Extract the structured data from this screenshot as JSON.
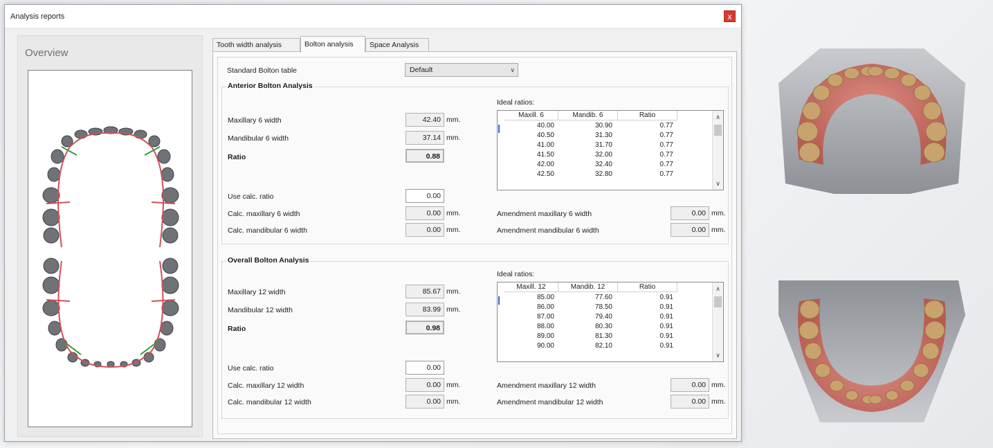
{
  "window": {
    "title": "Analysis reports",
    "close_glyph": "x"
  },
  "overview": {
    "title": "Overview"
  },
  "tabs": [
    {
      "label": "Tooth width analysis",
      "active": false
    },
    {
      "label": "Bolton analysis",
      "active": true
    },
    {
      "label": "Space Analysis",
      "active": false
    }
  ],
  "bolton": {
    "standard_table_label": "Standard Bolton table",
    "standard_table_value": "Default",
    "anterior": {
      "title": "Anterior Bolton Analysis",
      "maxillary_label": "Maxillary 6 width",
      "maxillary_value": "42.40",
      "mandibular_label": "Mandibular 6 width",
      "mandibular_value": "37.14",
      "ratio_label": "Ratio",
      "ratio_value": "0.88",
      "use_calc_label": "Use calc. ratio",
      "use_calc_value": "0.00",
      "calc_max_label": "Calc. maxillary 6 width",
      "calc_max_value": "0.00",
      "calc_mand_label": "Calc. mandibular 6 width",
      "calc_mand_value": "0.00",
      "ideal_label": "Ideal ratios:",
      "columns": [
        "Maxill. 6",
        "Mandib. 6",
        "Ratio"
      ],
      "rows": [
        [
          "40.00",
          "30.90",
          "0.77"
        ],
        [
          "40.50",
          "31.30",
          "0.77"
        ],
        [
          "41.00",
          "31.70",
          "0.77"
        ],
        [
          "41.50",
          "32.00",
          "0.77"
        ],
        [
          "42.00",
          "32.40",
          "0.77"
        ],
        [
          "42.50",
          "32.80",
          "0.77"
        ]
      ],
      "amend_max_label": "Amendment maxillary 6 width",
      "amend_max_value": "0.00",
      "amend_mand_label": "Amendment mandibular 6 width",
      "amend_mand_value": "0.00"
    },
    "overall": {
      "title": "Overall Bolton Analysis",
      "maxillary_label": "Maxillary 12 width",
      "maxillary_value": "85.67",
      "mandibular_label": "Mandibular 12 width",
      "mandibular_value": "83.99",
      "ratio_label": "Ratio",
      "ratio_value": "0.98",
      "use_calc_label": "Use calc. ratio",
      "use_calc_value": "0.00",
      "calc_max_label": "Calc. maxillary 12 width",
      "calc_max_value": "0.00",
      "calc_mand_label": "Calc. mandibular 12 width",
      "calc_mand_value": "0.00",
      "ideal_label": "Ideal ratios:",
      "columns": [
        "Maxill. 12",
        "Mandib. 12",
        "Ratio"
      ],
      "rows": [
        [
          "85.00",
          "77.60",
          "0.91"
        ],
        [
          "86.00",
          "78.50",
          "0.91"
        ],
        [
          "87.00",
          "79.40",
          "0.91"
        ],
        [
          "88.00",
          "80.30",
          "0.91"
        ],
        [
          "89.00",
          "81.30",
          "0.91"
        ],
        [
          "90.00",
          "82.10",
          "0.91"
        ]
      ],
      "amend_max_label": "Amendment maxillary 12 width",
      "amend_max_value": "0.00",
      "amend_mand_label": "Amendment mandibular 12 width",
      "amend_mand_value": "0.00"
    },
    "unit": "mm."
  },
  "colors": {
    "close_red": "#d33b2c",
    "gum_pink": "#c96a62",
    "tooth_tan": "#c9a36e",
    "cast_gray": "#9ea1a6",
    "arch_red": "#d0505a",
    "separator_green": "#3a9b3a"
  }
}
